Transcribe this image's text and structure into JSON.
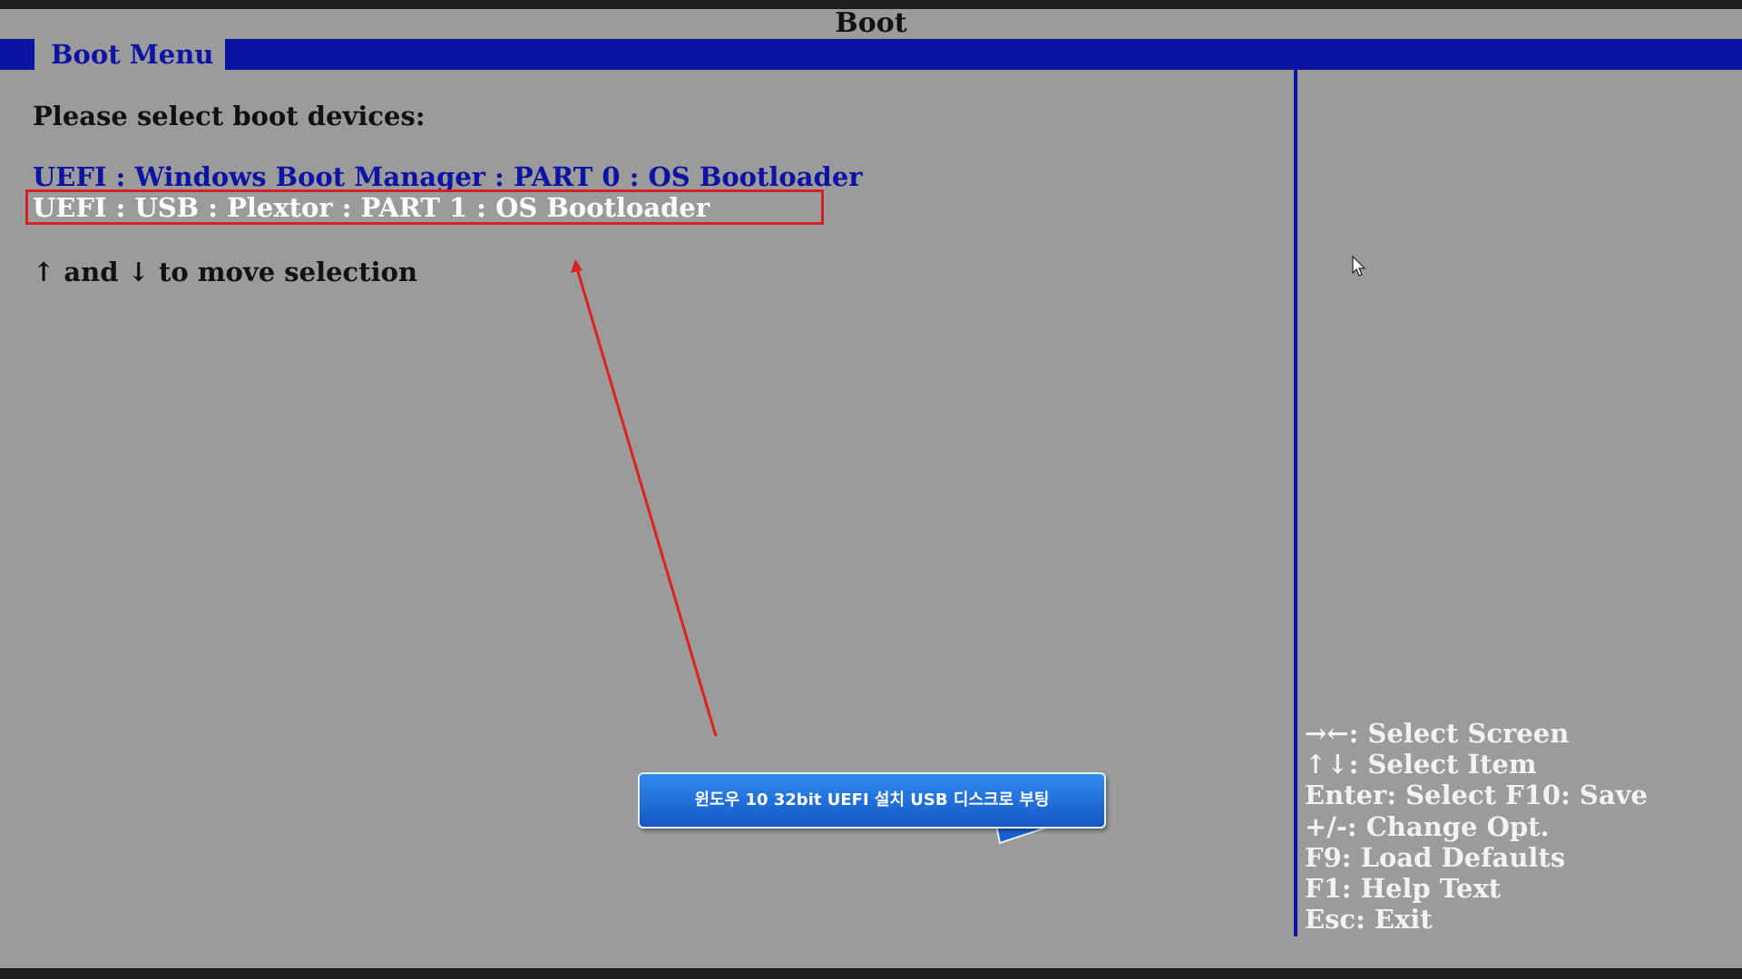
{
  "screen": {
    "title": "Boot"
  },
  "menubar": {
    "active_tab": "Boot Menu"
  },
  "main": {
    "prompt": "Please select boot devices:",
    "boot_devices": [
      {
        "label": "UEFI : Windows Boot Manager : PART 0 : OS Bootloader",
        "selected": false
      },
      {
        "label": "UEFI : USB : Plextor : PART 1 : OS Bootloader",
        "selected": true
      }
    ],
    "hint": "↑ and ↓ to move selection"
  },
  "help_panel": {
    "lines": [
      "→←: Select Screen",
      "↑↓: Select Item",
      "Enter: Select F10: Save",
      "+/-: Change Opt.",
      "F9: Load Defaults",
      "F1: Help Text",
      "Esc: Exit"
    ]
  },
  "annotation": {
    "callout_text": "윈도우 10 32bit UEFI 설치 USB 디스크로 부팅",
    "highlight_color": "#d42020",
    "callout_color": "#1f6fdb"
  },
  "colors": {
    "background": "#9b9b9b",
    "accent_blue": "#0d13a3",
    "selected_text": "#ffffff"
  }
}
